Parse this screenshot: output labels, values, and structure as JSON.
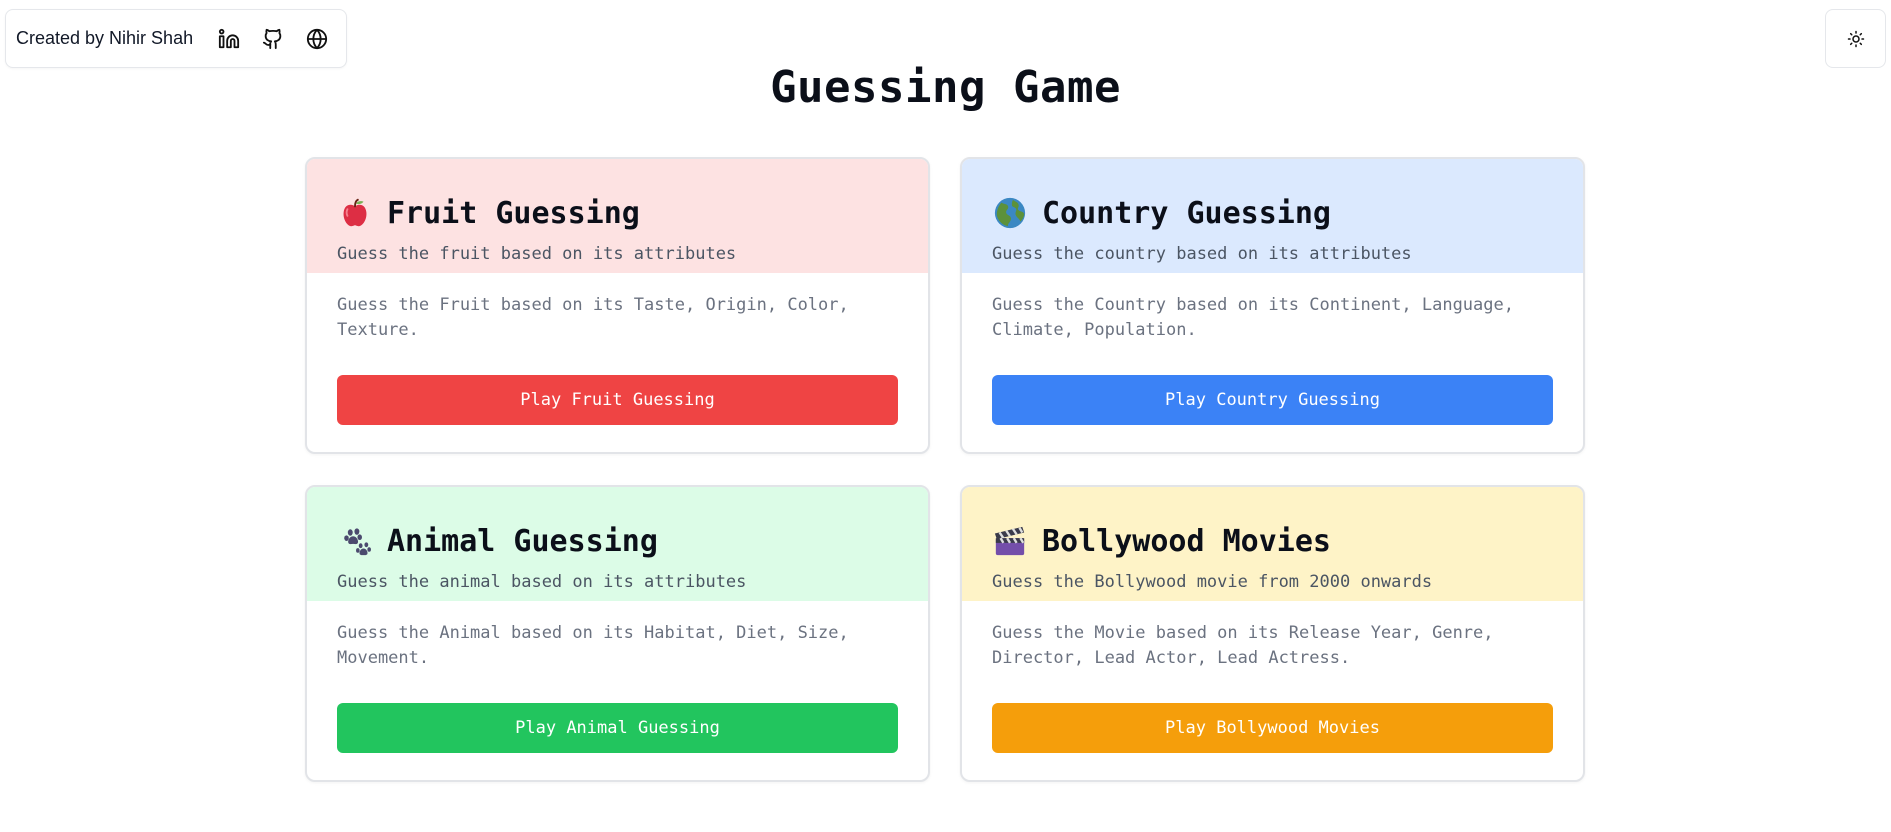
{
  "header": {
    "credit": "Created by Nihir Shah",
    "links": [
      {
        "icon": "linkedin-icon"
      },
      {
        "icon": "github-icon"
      },
      {
        "icon": "globe-icon"
      }
    ],
    "theme_toggle_icon": "sun-icon"
  },
  "page": {
    "title": "Guessing Game"
  },
  "cards": [
    {
      "emoji": "apple-emoji",
      "title": "Fruit Guessing",
      "subtitle": "Guess the fruit based on its attributes",
      "description": "Guess the Fruit based on its Taste, Origin, Color, Texture.",
      "button": "Play Fruit Guessing",
      "header_color": "#fde2e2",
      "button_color": "#ef4444"
    },
    {
      "emoji": "globe-europe-emoji",
      "title": "Country Guessing",
      "subtitle": "Guess the country based on its attributes",
      "description": "Guess the Country based on its Continent, Language, Climate, Population.",
      "button": "Play Country Guessing",
      "header_color": "#dbe9fe",
      "button_color": "#3b82f6"
    },
    {
      "emoji": "paw-prints-emoji",
      "title": "Animal Guessing",
      "subtitle": "Guess the animal based on its attributes",
      "description": "Guess the Animal based on its Habitat, Diet, Size, Movement.",
      "button": "Play Animal Guessing",
      "header_color": "#dcfce7",
      "button_color": "#22c55e"
    },
    {
      "emoji": "clapper-board-emoji",
      "title": "Bollywood Movies",
      "subtitle": "Guess the Bollywood movie from 2000 onwards",
      "description": "Guess the Movie based on its Release Year, Genre, Director, Lead Actor, Lead Actress.",
      "button": "Play Bollywood Movies",
      "header_color": "#fef3c7",
      "button_color": "#f59e0b"
    }
  ]
}
